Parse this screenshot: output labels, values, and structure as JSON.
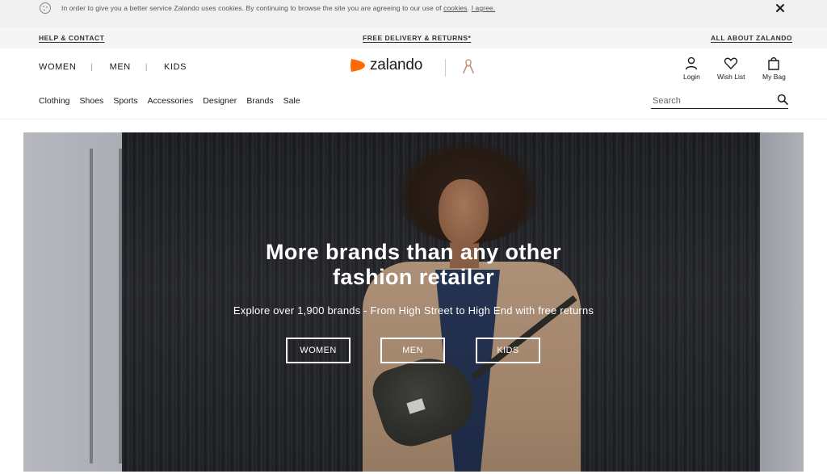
{
  "cookie_bar": {
    "text": "In order to give you a better service Zalando uses cookies. By continuing to browse the site you are agreeing to our use of",
    "link_cookies": "cookies",
    "link_agree": "I agree."
  },
  "service_bar": {
    "help": "HELP & CONTACT",
    "delivery": "FREE DELIVERY & RETURNS*",
    "about": "ALL ABOUT ZALANDO"
  },
  "header": {
    "genders": [
      "WOMEN",
      "MEN",
      "KIDS"
    ],
    "separator": "|",
    "logo_text": "zalando",
    "actions": {
      "login": "Login",
      "wishlist": "Wish List",
      "bag": "My Bag"
    },
    "categories": [
      "Clothing",
      "Shoes",
      "Sports",
      "Accessories",
      "Designer",
      "Brands",
      "Sale"
    ],
    "search": {
      "placeholder": "Search"
    }
  },
  "hero": {
    "title_line1": "More brands than any other",
    "title_line2": "fashion retailer",
    "subtitle": "Explore over 1,900 brands - From High Street to High End with free returns",
    "buttons": [
      "WOMEN",
      "MEN",
      "KIDS"
    ]
  },
  "colors": {
    "brand_orange": "#ff6900",
    "text": "#1a1a1a",
    "bar_bg": "#f0f0f0"
  },
  "icons": [
    "cookie-icon",
    "close-icon",
    "logo-icon",
    "ribbon-icon",
    "user-icon",
    "heart-icon",
    "bag-icon",
    "search-icon"
  ]
}
